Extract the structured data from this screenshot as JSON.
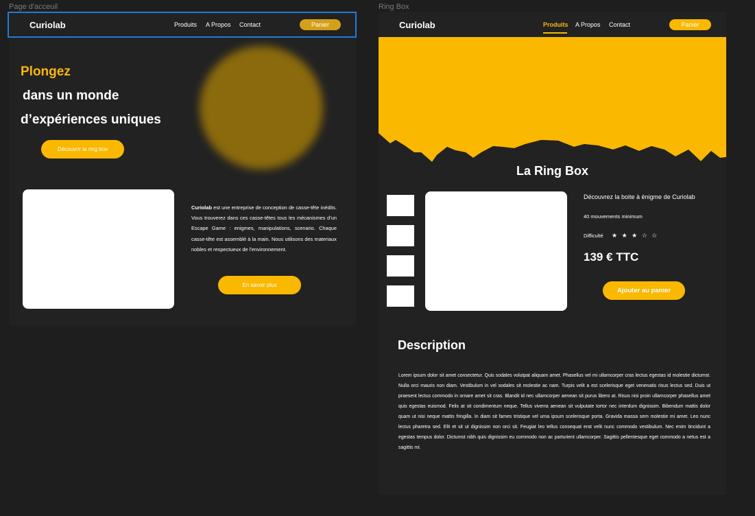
{
  "frames": {
    "home_label": "Page d'acceuil",
    "ringbox_label": "Ring Box"
  },
  "colors": {
    "canvas": "#1e1e1e",
    "frame_bg": "#222222",
    "accent": "#fbb800",
    "selection": "#1e7ed6"
  },
  "home": {
    "nav": {
      "brand": "Curiolab",
      "links": [
        "Produits",
        "A Propos",
        "Contact"
      ],
      "cart": "Panier"
    },
    "hero": {
      "line1": "Plongez",
      "line2": "dans un monde",
      "line3": "d’expériences uniques",
      "cta": "Découvrir la ring box"
    },
    "about": {
      "brand": "Curiolab",
      "text": " est une entreprise de conception de casse-tête inédits. Vous trouverez dans ces casse-têtes tous les mécanismes d’un Escape Game : enigmes, manipulations, scenario. Chaque casse-tête est assemblé à la main. Nous utilisons des materiaux nobles et respectueux de l’environnement.",
      "cta": "En savoir plus"
    }
  },
  "ringbox": {
    "nav": {
      "brand": "Curiolab",
      "links": [
        "Produits",
        "A Propos",
        "Contact"
      ],
      "active": "Produits",
      "cart": "Panier"
    },
    "title": "La Ring Box",
    "product": {
      "headline": "Découvrez la boite à énigme de Curiolab",
      "moves": "40 mouvements minimum",
      "difficulty_label": "Difficulté",
      "difficulty_stars": "★ ★ ★ ☆ ☆",
      "difficulty_value": "3/5",
      "price": "139 € TTC",
      "add_to_cart": "Ajouter au panier"
    },
    "description": {
      "title": "Description",
      "text": "Lorem ipsum dolor sit amet consectetur. Quis sodales volutpat aliquam amet. Phasellus vel mi ullamcorper cras lectus egestas id molestie dictumst. Nulla orci mauris non diam. Vestibulum in vel sodales sit molestie ac nam. Turpis velit a est scelerisque eget venenatis risus lectus sed. Duis ut praesent lectus commodo in ornare amet sit cras. Blandit id nec ullamcorper aenean sit purus libero at. Risus nisi proin ullamcorper phasellus amet quis egestas euismod. Felis at sit condimentum neque. Tellus viverra aenean sit vulputate tortor nec interdum dignissim. Bibendum mattis dolor quam ut nisi neque mattis fringilla. In diam sit fames tristique vel urna ipsum scelerisque porta. Gravida massa sem molestie mi amet. Leo nunc lectus pharetra sed. Elit et sit ut dignissim non orci sit. Feugiat leo tellus consequat erat velit nunc commodo vestibulum. Nec enim tincidunt a egestas tempus dolor. Dictumst nibh quis dignissim eu commodo non ac parturient ullamcorper. Sagittis pellentesque eget commodo a netus est a sagittis mi."
    }
  }
}
